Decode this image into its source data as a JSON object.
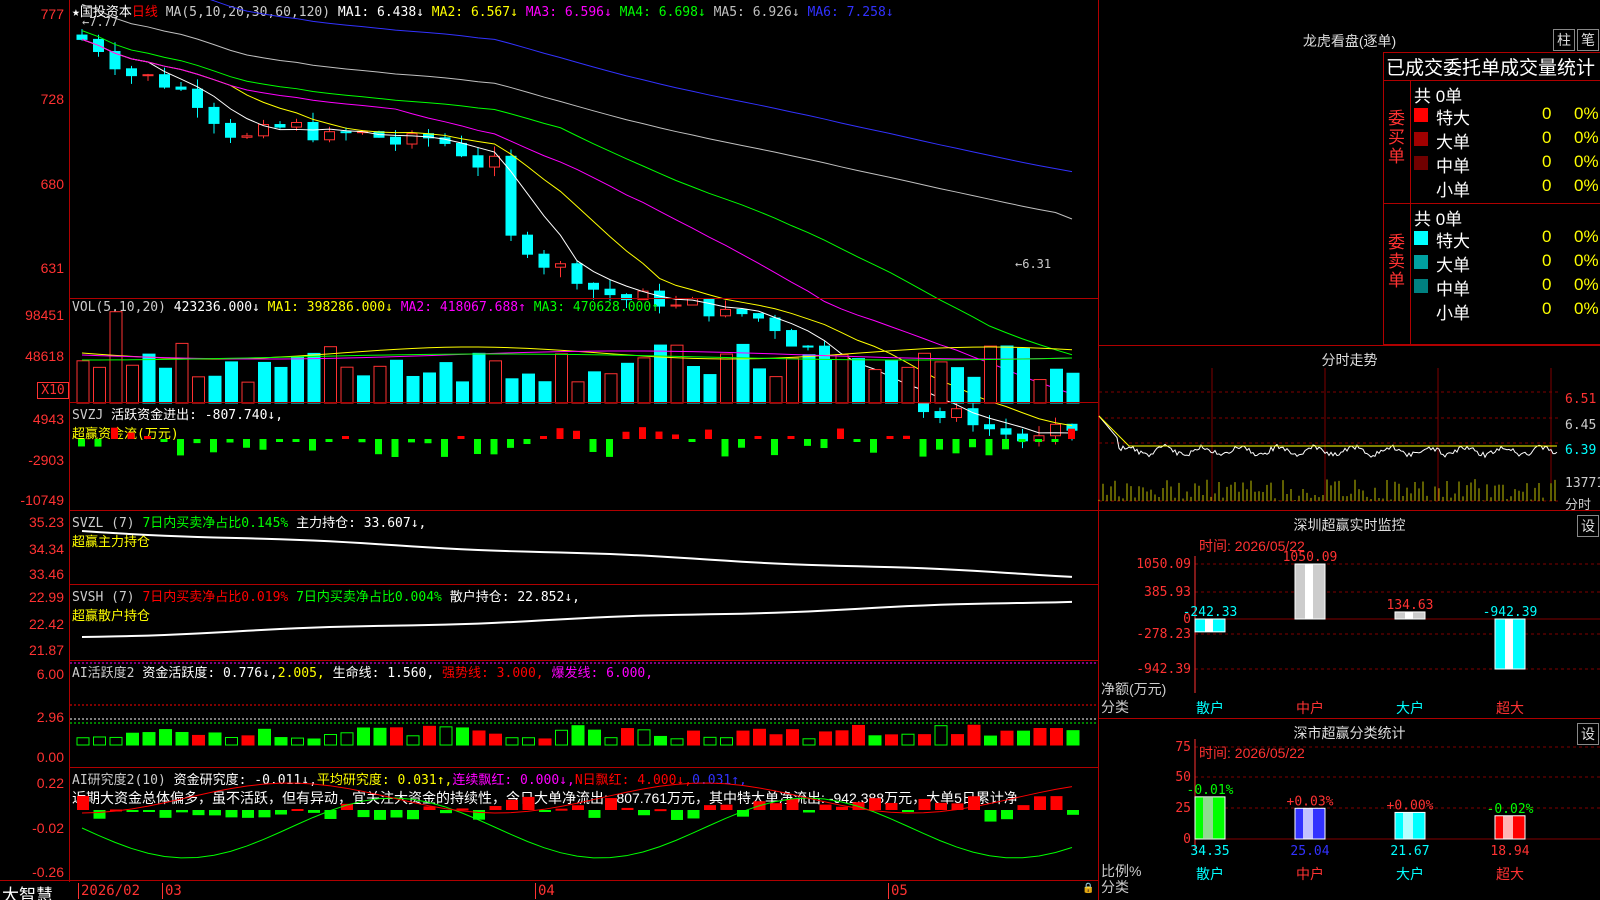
{
  "stock": {
    "name": "国投资本",
    "period": "日线",
    "star": "★"
  },
  "k": {
    "ma_label": "MA(5,10,20,30,60,120)",
    "mas": [
      {
        "label": "MA1:",
        "value": "6.438↓",
        "color": "#ffffff"
      },
      {
        "label": "MA2:",
        "value": "6.567↓",
        "color": "#ffff00"
      },
      {
        "label": "MA3:",
        "value": "6.596↓",
        "color": "#ff00ff"
      },
      {
        "label": "MA4:",
        "value": "6.698↓",
        "color": "#00ff00"
      },
      {
        "label": "MA5:",
        "value": "6.926↓",
        "color": "#c0c0c0"
      },
      {
        "label": "MA6:",
        "value": "7.258↓",
        "color": "#3232ff"
      }
    ],
    "yticks": [
      "777",
      "728",
      "680",
      "631"
    ],
    "high_label": "7.77",
    "low_label": "←6.31",
    "y_range": [
      6.2,
      7.9
    ]
  },
  "vol": {
    "title": "VOL(5,10,20)",
    "value": "423236.000↓",
    "ma": [
      {
        "label": "MA1:",
        "value": "398286.000↓",
        "color": "#ffff00"
      },
      {
        "label": "MA2:",
        "value": "418067.688↑",
        "color": "#ff00ff"
      },
      {
        "label": "MA3:",
        "value": "470628.000↑",
        "color": "#00ff00"
      }
    ],
    "yticks": [
      "98451",
      "48618"
    ],
    "unit": "X10"
  },
  "svzj": {
    "title": "SVZJ",
    "text": "活跃资金进出: -807.740↓,",
    "subtitle": "超赢资金流(万元)",
    "yticks": [
      "4943",
      "-2903",
      "-10749"
    ]
  },
  "svzl": {
    "title": "SVZL (7)",
    "text1": "7日内买卖净占比0.145%",
    "text2": "主力持仓: 33.607↓,",
    "subtitle": "超赢主力持仓",
    "yticks": [
      "35.23",
      "34.34",
      "33.46"
    ]
  },
  "svsh": {
    "title": "SVSH (7)",
    "text1": "7日内买卖净占比0.019%",
    "text2": "7日内买卖净占比0.004%",
    "text3": "散户持仓: 22.852↓,",
    "subtitle": "超赢散户持仓",
    "yticks": [
      "22.99",
      "22.42",
      "21.87"
    ]
  },
  "ai1": {
    "title": "AI活跃度2",
    "t1": "资金活跃度: 0.776↓,",
    "t2": "2.005,",
    "t3": "生命线: 1.560,",
    "t4": "强势线: 3.000,",
    "t5": "爆发线: 6.000,",
    "yticks": [
      "6.00",
      "2.96",
      "0.00"
    ]
  },
  "ai2": {
    "title": "AI研究度2(10)",
    "t1": "资金研究度: -0.011↓,",
    "t2": "平均研究度: 0.031↑,",
    "t3": "连续飘红: 0.000↓,",
    "t4": "N日飘红: 4.000↓,",
    "t5": "0.031↑,",
    "comment": "近期大资金总体偏多，虽不活跃，但有异动，宜关注大资金的持续性，今日大单净流出: -807.761万元，其中特大单净流出: -942.388万元，大单5日累计净",
    "yticks": [
      "0.22",
      "-0.02",
      "-0.26"
    ]
  },
  "footer": {
    "brand": "大智慧",
    "date": "2026/02",
    "m1": "03",
    "m2": "04",
    "m3": "05"
  },
  "lhb": {
    "title": "龙虎看盘(逐单)",
    "btn1": "柱",
    "btn2": "笔",
    "header": "已成交委托单成交量统计",
    "buy_label": "委买单",
    "sell_label": "委卖单",
    "buy_total": "共 0单",
    "sell_total": "共 0单",
    "buy": [
      {
        "name": "特大",
        "count": "0",
        "pct": "0%",
        "color": "#ff0000"
      },
      {
        "name": "大单",
        "count": "0",
        "pct": "0%",
        "color": "#a00000"
      },
      {
        "name": "中单",
        "count": "0",
        "pct": "0%",
        "color": "#700000"
      },
      {
        "name": "小单",
        "count": "0",
        "pct": "0%",
        "color": "#000000"
      }
    ],
    "sell": [
      {
        "name": "特大",
        "count": "0",
        "pct": "0%",
        "color": "#00ffff"
      },
      {
        "name": "大单",
        "count": "0",
        "pct": "0%",
        "color": "#00a0a0"
      },
      {
        "name": "中单",
        "count": "0",
        "pct": "0%",
        "color": "#008080"
      },
      {
        "name": "小单",
        "count": "0",
        "pct": "0%",
        "color": "#000000"
      }
    ]
  },
  "fenshi": {
    "title": "分时走势",
    "prices": [
      "6.51",
      "6.45",
      "6.39"
    ],
    "vol": "13771",
    "vol_unit": "分时"
  },
  "szmon": {
    "title": "深圳超赢实时监控",
    "btn": "设",
    "time": "时间: 2026/05/22",
    "yticks": [
      "1050.09",
      "385.93",
      "0",
      "-278.23",
      "-942.39"
    ],
    "ylabel": "净额(万元)",
    "xlabel": "分类",
    "cats": [
      "散户",
      "中户",
      "大户",
      "超大"
    ],
    "values": [
      -242.33,
      1050.09,
      134.63,
      -942.39
    ],
    "value_labels": [
      "-242.33",
      "1050.09",
      "134.63",
      "-942.39"
    ]
  },
  "szstat": {
    "title": "深市超赢分类统计",
    "btn": "设",
    "time": "时间: 2026/05/22",
    "yticks": [
      "75",
      "50",
      "25",
      "0"
    ],
    "ylabel": "比例%",
    "xlabel": "分类",
    "cats": [
      "散户",
      "中户",
      "大户",
      "超大"
    ],
    "values": [
      34.35,
      25.04,
      21.67,
      18.94
    ],
    "changes": [
      "-0.01%",
      "+0.03%",
      "+0.00%",
      "-0.02%"
    ]
  }
}
